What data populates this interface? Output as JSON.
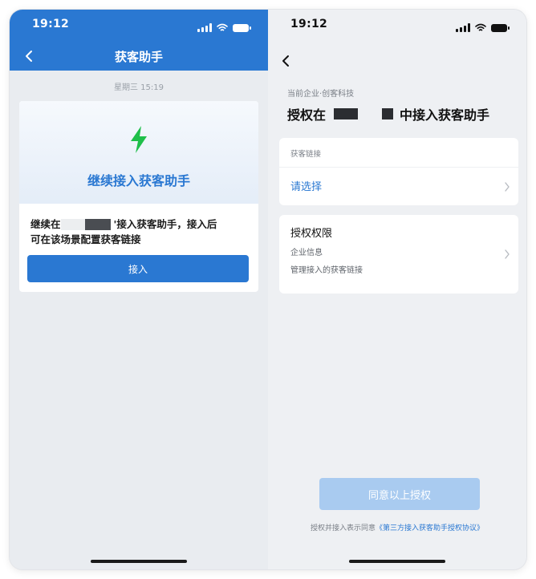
{
  "left": {
    "status": {
      "time": "19:12"
    },
    "nav": {
      "title": "获客助手"
    },
    "timestamp": "星期三 15:19",
    "card": {
      "title": "继续接入获客助手",
      "line1_prefix": "继续在",
      "line1_suffix": "'接入获客助手，接入后",
      "line2": "可在该场景配置获客链接",
      "button": "接入"
    }
  },
  "right": {
    "status": {
      "time": "19:12"
    },
    "company": "当前企业·创客科技",
    "title_prefix": "授权在",
    "title_suffix": "中接入获客助手",
    "link_section": {
      "label": "获客链接",
      "placeholder": "请选择"
    },
    "permission": {
      "title": "授权权限",
      "item1": "企业信息",
      "item2": "管理接入的获客链接"
    },
    "agree_button": "同意以上授权",
    "agreement_prefix": "授权并接入表示同意",
    "agreement_link": "《第三方接入获客助手授权协议》"
  },
  "colors": {
    "brand_blue": "#2a78d2",
    "disabled_blue": "#a9cbf0",
    "bolt_green": "#1fbf4a"
  },
  "icons": [
    "back-arrow-icon",
    "signal-icon",
    "wifi-icon",
    "battery-icon",
    "lightning-bolt-icon",
    "chevron-right-icon"
  ]
}
